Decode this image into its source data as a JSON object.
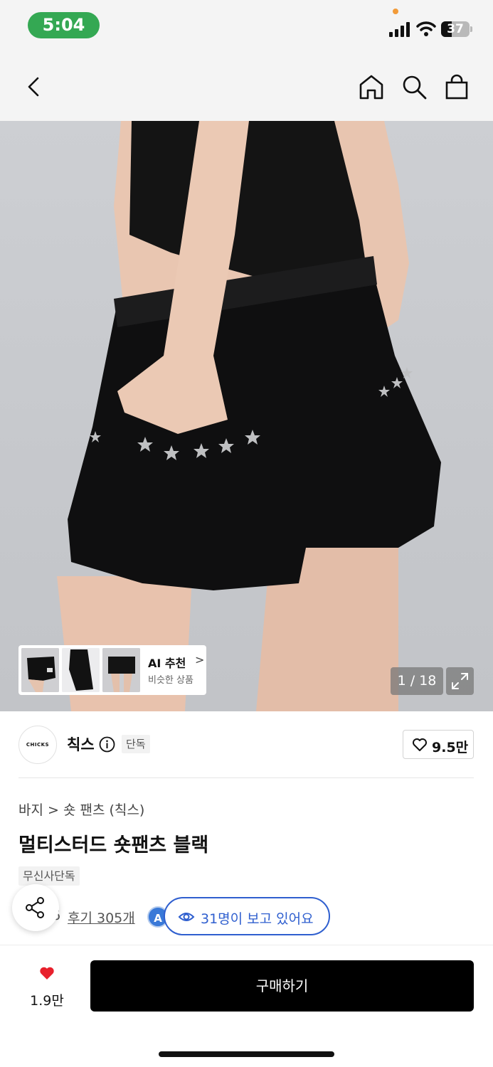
{
  "status_bar": {
    "time": "5:04",
    "battery": "37",
    "battery_level": 0.37
  },
  "top_nav": {
    "back": "back-icon",
    "home": "home-icon",
    "search": "search-icon",
    "cart": "shopping-bag-icon"
  },
  "gallery": {
    "counter": "1 / 18",
    "ai_recommend": {
      "title": "AI 추천",
      "subtitle": "비슷한 상품",
      "chevron": ">"
    }
  },
  "brand": {
    "logo_text": "CHICKS",
    "name": "칙스",
    "badge": "단독",
    "likes": "9.5만"
  },
  "breadcrumb": {
    "category": "바지",
    "separator": ">",
    "subcategory": "숏 팬츠 (칙스)"
  },
  "product": {
    "title": "멀티스터드 숏팬츠 블랙",
    "badge": "무신사단독",
    "rating_partial": "6",
    "reviews": "후기 305개",
    "a_badge": "A",
    "viewers": "31명이 보고 있어요"
  },
  "bottom_bar": {
    "likes": "1.9만",
    "buy_label": "구매하기"
  },
  "colors": {
    "accent_blue": "#2f5fcf",
    "heart_red": "#e8202c",
    "status_green": "#34a853"
  }
}
